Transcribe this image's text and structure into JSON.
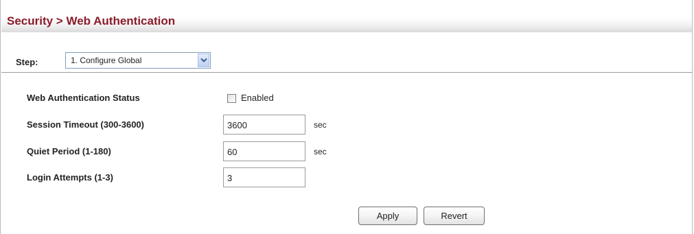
{
  "header": {
    "title": "Security > Web Authentication"
  },
  "step": {
    "label": "Step:",
    "selected": "1. Configure Global"
  },
  "form": {
    "status_label": "Web Authentication Status",
    "status_checkbox_label": "Enabled",
    "status_checked": false,
    "session_timeout_label": "Session Timeout (300-3600)",
    "session_timeout_value": "3600",
    "session_timeout_unit": "sec",
    "quiet_period_label": "Quiet Period (1-180)",
    "quiet_period_value": "60",
    "quiet_period_unit": "sec",
    "login_attempts_label": "Login Attempts (1-3)",
    "login_attempts_value": "3"
  },
  "buttons": {
    "apply": "Apply",
    "revert": "Revert"
  },
  "icons": {
    "dropdown": "chevron-down-icon"
  },
  "colors": {
    "title": "#8a1c2a",
    "dropdown_button": "#bfd0f2"
  }
}
